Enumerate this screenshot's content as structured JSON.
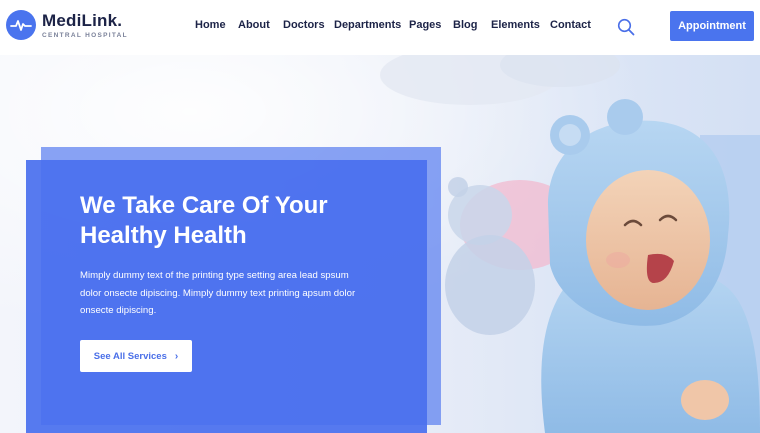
{
  "brand": {
    "name": "MediLink.",
    "tagline": "CENTRAL HOSPITAL",
    "accent": "#4a74ee"
  },
  "nav": {
    "items": [
      {
        "label": "Home"
      },
      {
        "label": "About"
      },
      {
        "label": "Doctors"
      },
      {
        "label": "Departments"
      },
      {
        "label": "Pages"
      },
      {
        "label": "Blog"
      },
      {
        "label": "Elements"
      },
      {
        "label": "Contact"
      }
    ],
    "search_icon": "search-icon",
    "cta_label": "Appointment"
  },
  "hero": {
    "title": "We Take Care Of Your Healthy Health",
    "description": "Mimply dummy text of the printing type setting area lead spsum dolor onsecte dipiscing. Mimply dummy text printing apsum dolor onsecte dipiscing.",
    "button_label": "See All Services",
    "button_icon": "chevron-right-icon",
    "card_color": "#4a70ee",
    "image_subject": "baby-in-blue-bathrobe-photo"
  }
}
